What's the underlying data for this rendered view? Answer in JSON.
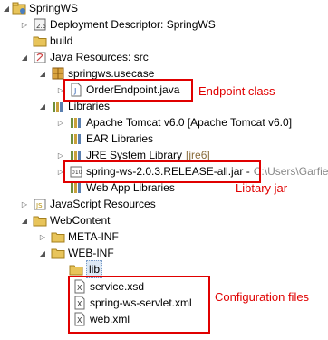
{
  "tree": {
    "project": "SpringWS",
    "deployment_descriptor": "Deployment Descriptor: SpringWS",
    "build": "build",
    "java_resources": "Java Resources: src",
    "package": "springws.usecase",
    "order_endpoint": "OrderEndpoint.java",
    "libraries": "Libraries",
    "tomcat": "Apache Tomcat v6.0 [Apache Tomcat v6.0]",
    "ear_libraries": "EAR Libraries",
    "jre_system_library": "JRE System Library",
    "jre_version": "[jre6]",
    "spring_jar": "spring-ws-2.0.3.RELEASE-all.jar -",
    "spring_jar_path": "C:\\Users\\Garfield",
    "web_app_libraries": "Web App Libraries",
    "javascript_resources": "JavaScript Resources",
    "webcontent": "WebContent",
    "meta_inf": "META-INF",
    "web_inf": "WEB-INF",
    "lib": "lib",
    "service_xsd": "service.xsd",
    "servlet_xml": "spring-ws-servlet.xml",
    "web_xml": "web.xml"
  },
  "annotations": {
    "endpoint": "Endpoint class",
    "library": "Libtary jar",
    "config": "Configuration files"
  },
  "colors": {
    "annotation_red": "#e00000",
    "folder_yellow": "#e8c45a",
    "selection_bg": "#dde9f5"
  }
}
